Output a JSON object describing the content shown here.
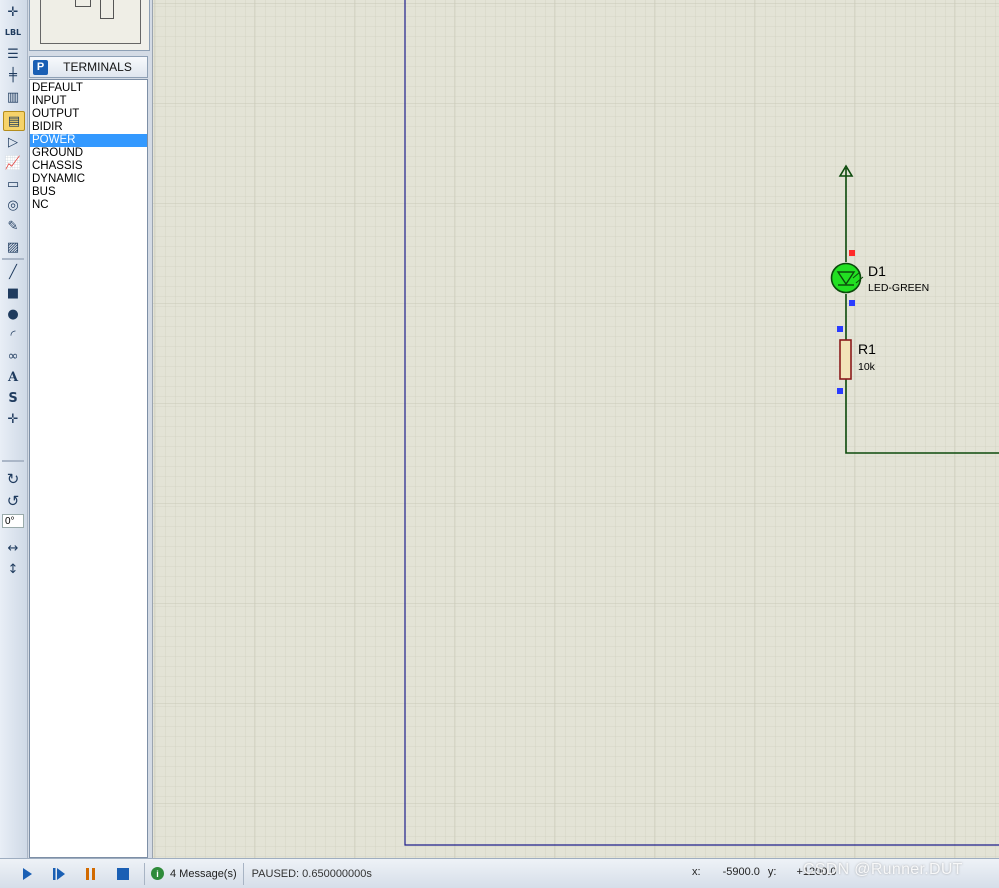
{
  "terminals_panel": {
    "button_label": "P",
    "title": "TERMINALS",
    "items": [
      "DEFAULT",
      "INPUT",
      "OUTPUT",
      "BIDIR",
      "POWER",
      "GROUND",
      "CHASSIS",
      "DYNAMIC",
      "BUS",
      "NC"
    ],
    "selected": "POWER"
  },
  "toolbar": {
    "label_mode_text": "LBL",
    "rotation_value": "0°",
    "text_tool_glyph": "A",
    "symbol_tool_glyph": "S"
  },
  "schematic": {
    "components": [
      {
        "ref": "D1",
        "value": "LED-GREEN"
      },
      {
        "ref": "R1",
        "value": "10k"
      }
    ],
    "colors": {
      "grid_background": "#e3e3d6",
      "grid_line": "#c9c9b8",
      "sheet_border": "#1e1e8c",
      "wire": "#0c4a0c",
      "led_fill": "#22e022",
      "resistor_body": "#f3e3b8",
      "resistor_outline": "#8b1a1a",
      "pin_blue": "#2a3cff",
      "pin_red": "#ff2a2a"
    }
  },
  "statusbar": {
    "messages": "4 Message(s)",
    "status": "PAUSED: 0.650000000s",
    "x_label": "x:",
    "x_value": "-5900.0",
    "y_label": "y:",
    "y_value": "+1200.0",
    "watermark": "CSDN @Runner.DUT"
  }
}
